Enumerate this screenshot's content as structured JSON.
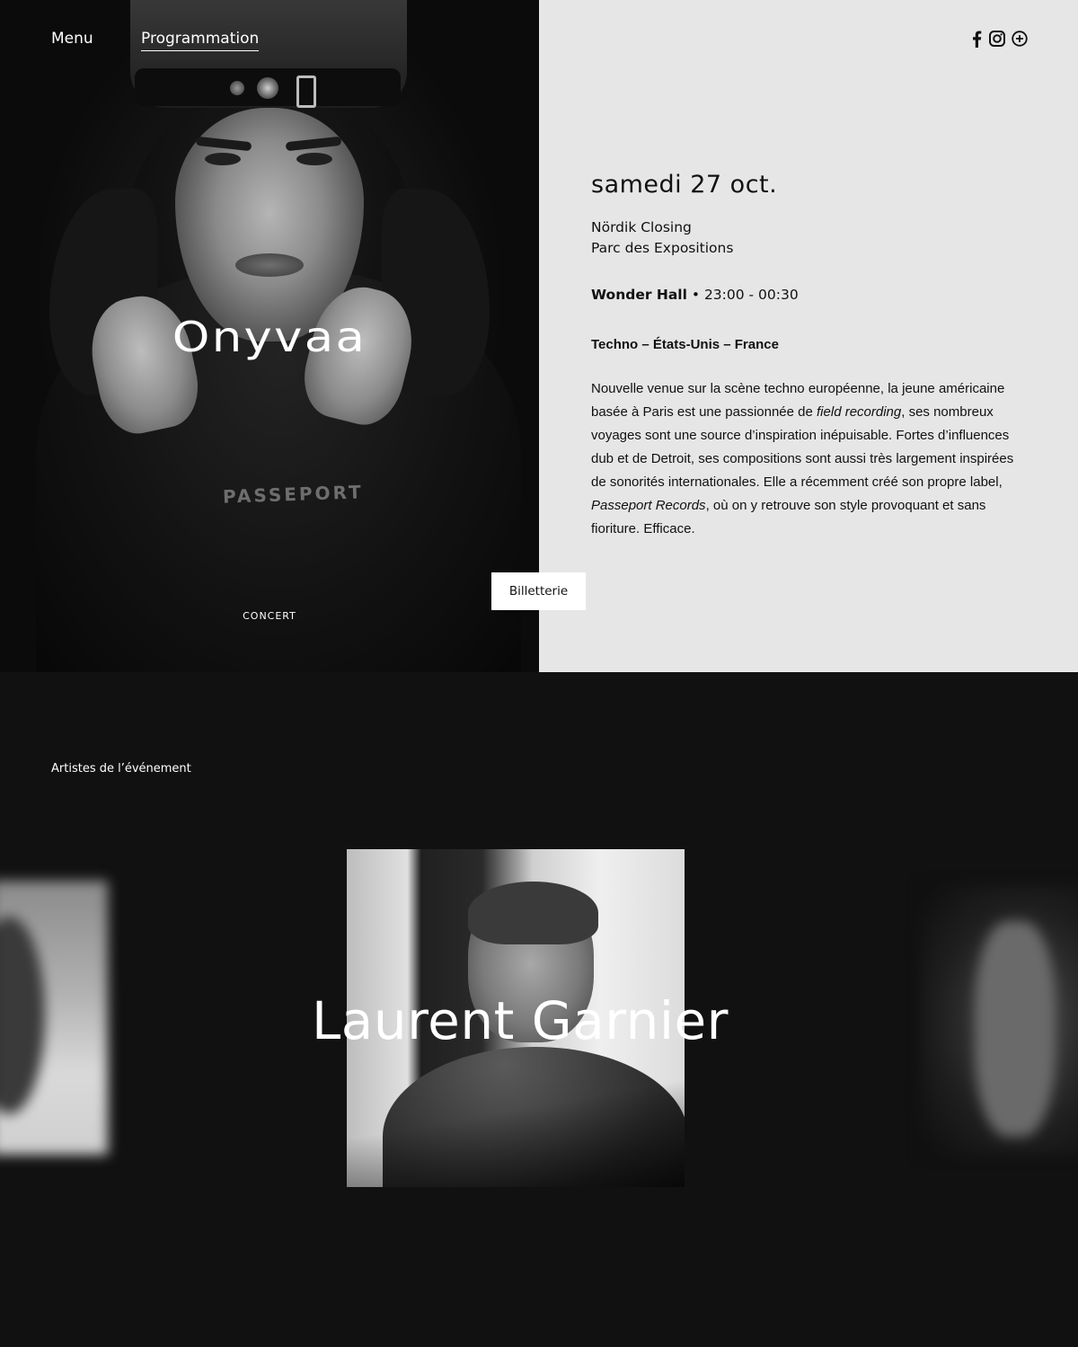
{
  "nav": {
    "menu_label": "Menu",
    "programmation_label": "Programmation"
  },
  "social": {
    "icons": [
      "facebook-icon",
      "instagram-icon",
      "plus-circle-icon"
    ]
  },
  "hero": {
    "artist_name": "Onyvaa",
    "category": "CONCERT",
    "shirt_print": "PASSEPORT"
  },
  "event": {
    "date": "samedi 27 oct.",
    "name": "Nördik Closing",
    "venue": "Parc des Expositions",
    "stage": "Wonder Hall",
    "separator": " • ",
    "time": "23:00 - 00:30",
    "genre": "Techno – États-Unis – France",
    "description": {
      "p1": "Nouvelle venue sur la scène techno européenne, la jeune américaine basée à Paris est une passionnée de ",
      "em1": "field recording",
      "p2": ", ses nombreux voyages sont une source d’inspiration inépuisable. Fortes d’influences dub et de Detroit, ses compositions sont aussi très largement inspirées de sonorités internationales. Elle a récemment créé son propre label, ",
      "em2": "Passeport Records",
      "p3": ", où on y retrouve son style provoquant et sans fioriture. Efficace."
    },
    "tickets_label": "Billetterie"
  },
  "artists": {
    "section_title": "Artistes de l’événement",
    "featured_name": "Laurent Garnier"
  },
  "colors": {
    "dark_bg": "#111111",
    "light_panel": "#e6e6e6",
    "text_dark": "#111111",
    "text_light": "#ffffff"
  }
}
